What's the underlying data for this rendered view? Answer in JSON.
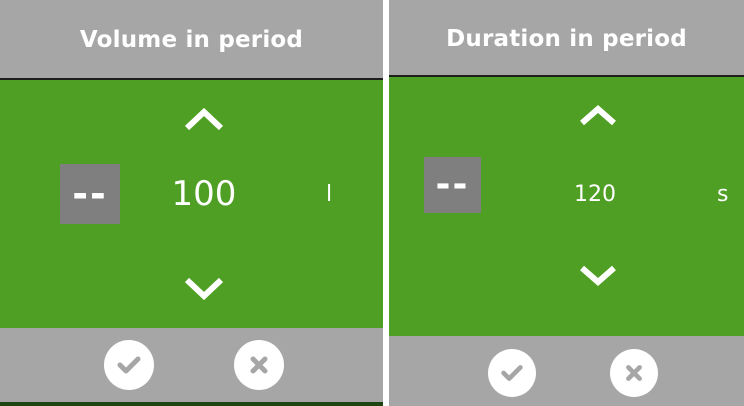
{
  "volume_dialog": {
    "title": "Volume in period",
    "sign_symbol": "--",
    "value": "100",
    "unit": "l",
    "icons": {
      "increase": "chevron-up-icon",
      "decrease": "chevron-down-icon",
      "confirm": "check-icon",
      "cancel": "close-icon"
    }
  },
  "duration_dialog": {
    "title": "Duration in period",
    "sign_symbol": "--",
    "value": "120",
    "unit": "s",
    "icons": {
      "increase": "chevron-up-icon",
      "decrease": "chevron-down-icon",
      "confirm": "check-icon",
      "cancel": "close-icon"
    }
  },
  "colors": {
    "header_gray": "#a6a6a6",
    "panel_green": "#4f9f25",
    "sign_button_gray": "#7f7f7f",
    "icon_white": "#ffffff"
  }
}
